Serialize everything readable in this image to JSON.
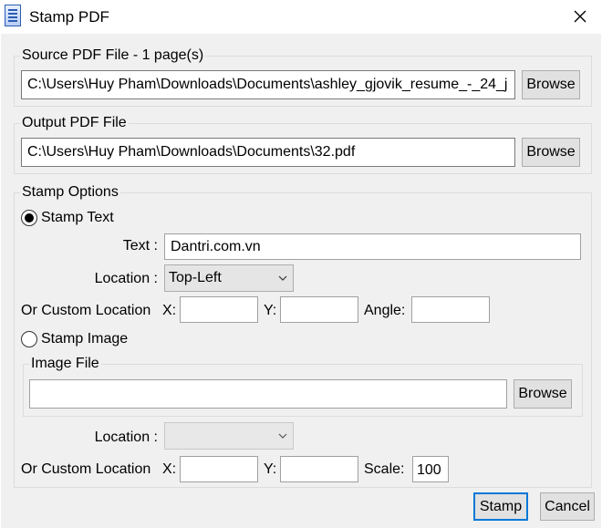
{
  "window": {
    "title": "Stamp PDF",
    "close_icon": "close-icon",
    "app_icon": "sheet-app-icon"
  },
  "source": {
    "legend": "Source PDF File - 1 page(s)",
    "path": "C:\\Users\\Huy Pham\\Downloads\\Documents\\ashley_gjovik_resume_-_24_j",
    "browse": "Browse"
  },
  "output": {
    "legend": "Output PDF File",
    "path": "C:\\Users\\Huy Pham\\Downloads\\Documents\\32.pdf",
    "browse": "Browse"
  },
  "options": {
    "legend": "Stamp Options",
    "stamp_text": {
      "label": "Stamp Text",
      "selected": true,
      "text_label": "Text :",
      "text_value": "Dantri.com.vn",
      "location_label": "Location :",
      "location_value": "Top-Left",
      "custom_label": "Or Custom Location",
      "x_label": "X:",
      "y_label": "Y:",
      "angle_label": "Angle:",
      "x_value": "",
      "y_value": "",
      "angle_value": ""
    },
    "stamp_image": {
      "label": "Stamp Image",
      "selected": false,
      "file_legend": "Image File",
      "file_value": "",
      "browse": "Browse",
      "location_label": "Location :",
      "location_value": "",
      "custom_label": "Or Custom Location",
      "x_label": "X:",
      "y_label": "Y:",
      "scale_label": "Scale:",
      "x_value": "",
      "y_value": "",
      "scale_value": "100"
    }
  },
  "footer": {
    "stamp": "Stamp",
    "cancel": "Cancel"
  }
}
